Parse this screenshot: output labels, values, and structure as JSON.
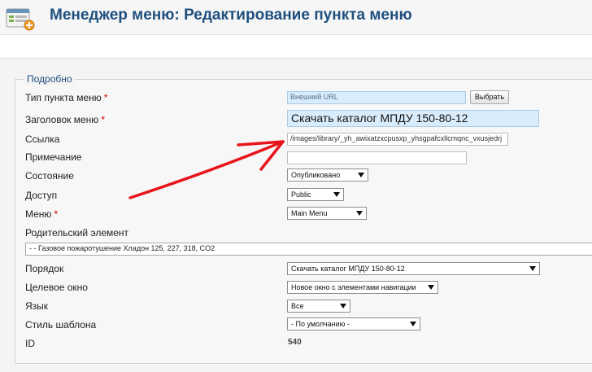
{
  "header": {
    "title": "Менеджер меню: Редактирование пункта меню",
    "icon": "menu-manager-icon"
  },
  "details": {
    "legend": "Подробно",
    "fields": {
      "type": {
        "label": "Тип пункта меню",
        "required": "*",
        "value": "Внешний URL",
        "button": "Выбрать"
      },
      "title": {
        "label": "Заголовок меню",
        "required": "*",
        "value": "Скачать каталог МПДУ 150-80-12"
      },
      "link": {
        "label": "Ссылка",
        "value": "/images/library/_yh_awixatzxcpusxp_yhsgpafcxllcmqnc_vxusjedrj"
      },
      "note": {
        "label": "Примечание",
        "value": ""
      },
      "state": {
        "label": "Состояние",
        "value": "Опубликовано"
      },
      "access": {
        "label": "Доступ",
        "value": "Public"
      },
      "menu": {
        "label": "Меню",
        "required": "*",
        "value": "Main Menu"
      },
      "parent": {
        "label": "Родительский элемент",
        "value": "- - Газовое пожаротушение Хладон 125, 227, 318, CO2"
      },
      "order": {
        "label": "Порядок",
        "value": "Скачать каталог МПДУ 150-80-12"
      },
      "target": {
        "label": "Целевое окно",
        "value": "Новое окно с элементами навигации"
      },
      "language": {
        "label": "Язык",
        "value": "Все"
      },
      "template": {
        "label": "Стиль шаблона",
        "value": "- По умолчанию -"
      },
      "id": {
        "label": "ID",
        "value": "540"
      }
    }
  },
  "annotation": {
    "color": "#e8141c"
  }
}
